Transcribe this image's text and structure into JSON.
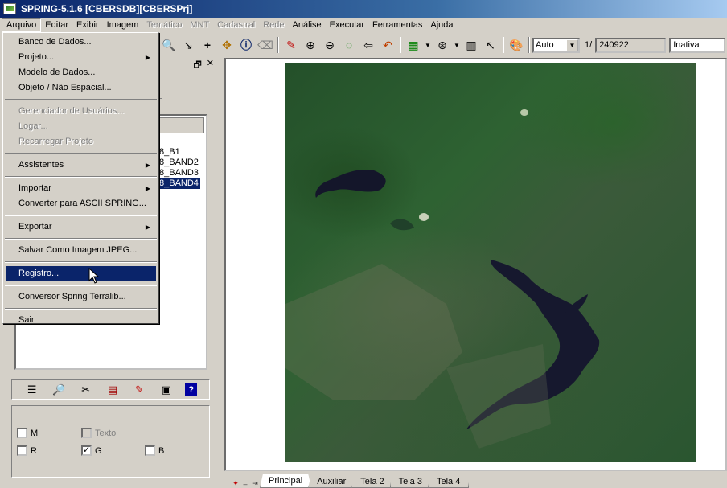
{
  "window": {
    "title": "SPRING-5.1.6 [CBERSDB][CBERSPrj]"
  },
  "menubar": {
    "items": [
      {
        "label": "Arquivo",
        "state": "active"
      },
      {
        "label": "Editar",
        "state": "normal"
      },
      {
        "label": "Exibir",
        "state": "normal"
      },
      {
        "label": "Imagem",
        "state": "normal"
      },
      {
        "label": "Temático",
        "state": "disabled"
      },
      {
        "label": "MNT",
        "state": "disabled"
      },
      {
        "label": "Cadastral",
        "state": "disabled"
      },
      {
        "label": "Rede",
        "state": "disabled"
      },
      {
        "label": "Análise",
        "state": "normal"
      },
      {
        "label": "Executar",
        "state": "normal"
      },
      {
        "label": "Ferramentas",
        "state": "normal"
      },
      {
        "label": "Ajuda",
        "state": "normal"
      }
    ]
  },
  "arquivo_menu": {
    "banco": "Banco de Dados...",
    "projeto": "Projeto...",
    "modelo": "Modelo de Dados...",
    "objeto": "Objeto / Não Espacial...",
    "gerenciador": "Gerenciador de Usuários...",
    "logar": "Logar...",
    "recarregar": "Recarregar Projeto",
    "assistentes": "Assistentes",
    "importar": "Importar",
    "converter_ascii": "Converter para ASCII SPRING...",
    "exportar": "Exportar",
    "salvar_jpeg": "Salvar Como Imagem JPEG...",
    "registro": "Registro...",
    "conversor": "Conversor Spring Terralib...",
    "sair": "Sair"
  },
  "toolbar": {
    "scale_mode": "Auto",
    "scale_prefix": "1/",
    "scale_value": "240922",
    "status": "Inativa"
  },
  "layers": {
    "items": [
      "8_B1",
      "8_BAND2",
      "8_BAND3",
      "8_BAND4"
    ],
    "selected_index": 3
  },
  "channels": {
    "m": "M",
    "texto": "Texto",
    "r": "R",
    "g": "G",
    "b": "B",
    "g_checked": "✓"
  },
  "tabs": [
    "Principal",
    "Auxiliar",
    "Tela 2",
    "Tela 3",
    "Tela 4"
  ],
  "icons": {
    "help": "?"
  }
}
